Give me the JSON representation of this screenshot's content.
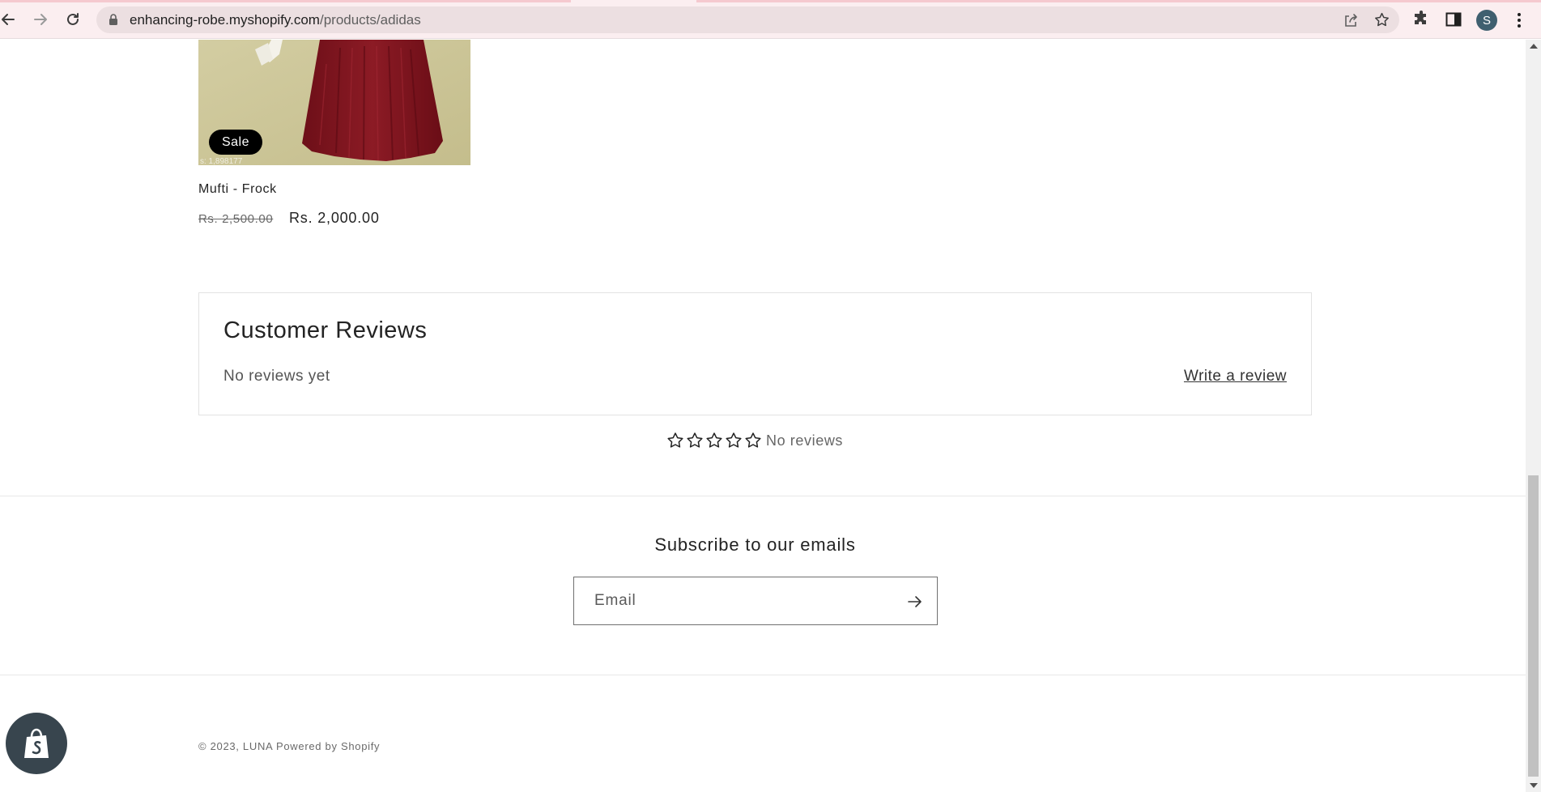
{
  "browser": {
    "url_domain": "enhancing-robe.myshopify.com",
    "url_path": "/products/adidas",
    "profile_initial": "S",
    "icons": [
      "back-icon",
      "forward-icon",
      "reload-icon",
      "lock-icon",
      "share-icon",
      "bookmark-star-icon",
      "extensions-icon",
      "side-panel-icon",
      "more-menu-icon"
    ]
  },
  "product": {
    "badge": "Sale",
    "title": "Mufti - Frock",
    "price_original": "Rs. 2,500.00",
    "price_sale": "Rs. 2,000.00",
    "image_watermark": "s: 1,898177"
  },
  "reviews": {
    "heading": "Customer Reviews",
    "empty_text": "No reviews yet",
    "write_review_label": "Write a review",
    "rating_stars": 0,
    "rating_max": 5,
    "summary_text": "No reviews"
  },
  "newsletter": {
    "heading": "Subscribe to our emails",
    "email_placeholder": "Email"
  },
  "footer": {
    "copyright": "© 2023, LUNA Powered by Shopify"
  },
  "colors": {
    "chrome_bg": "#fbeef0",
    "omnibox_bg": "#ecdfe1",
    "badge_bg": "#000000",
    "text": "#232323",
    "shopify_bag": "#38454e"
  }
}
